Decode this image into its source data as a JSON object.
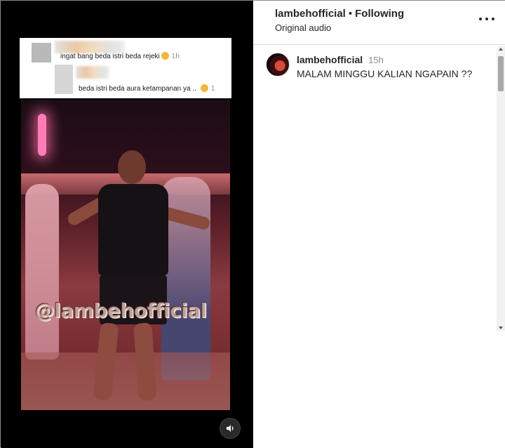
{
  "media": {
    "comments": [
      {
        "text": "ingat bang beda istri beda rejeki",
        "time": "1h"
      },
      {
        "text": "beda istri beda aura ketampanan ya ..",
        "time": "1"
      }
    ],
    "watermark": "@lambehofficial",
    "sound_icon": "speaker-icon"
  },
  "header": {
    "username": "lambehofficial",
    "separator": "•",
    "follow_status": "Following",
    "audio": "Original audio",
    "more_icon": "more-options-icon"
  },
  "post": {
    "username": "lambehofficial",
    "time": "15h",
    "caption": "MALAM MINGGU KALIAN NGAPAIN ??"
  }
}
